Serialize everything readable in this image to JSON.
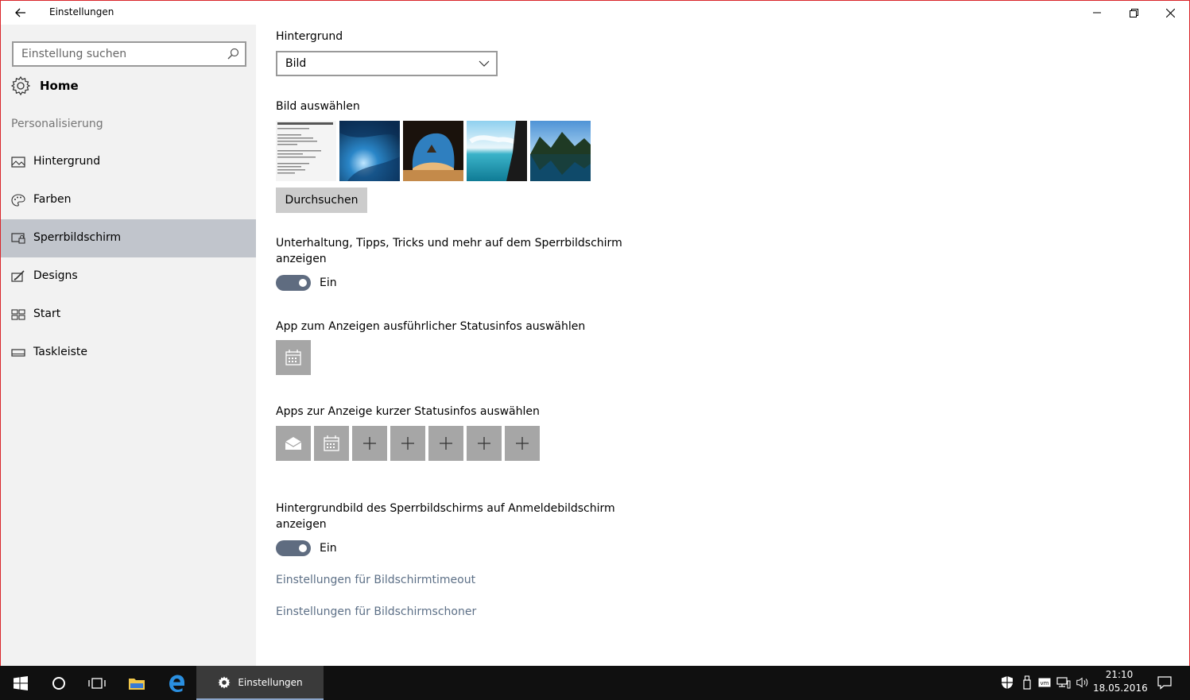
{
  "window": {
    "title": "Einstellungen"
  },
  "sidebar": {
    "search_placeholder": "Einstellung suchen",
    "home_label": "Home",
    "section_title": "Personalisierung",
    "items": [
      {
        "label": "Hintergrund",
        "icon": "image-icon",
        "active": false
      },
      {
        "label": "Farben",
        "icon": "palette-icon",
        "active": false
      },
      {
        "label": "Sperrbildschirm",
        "icon": "lockscreen-icon",
        "active": true
      },
      {
        "label": "Designs",
        "icon": "designs-icon",
        "active": false
      },
      {
        "label": "Start",
        "icon": "start-icon",
        "active": false
      },
      {
        "label": "Taskleiste",
        "icon": "taskbar-icon",
        "active": false
      }
    ]
  },
  "content": {
    "background_label": "Hintergrund",
    "background_value": "Bild",
    "choose_image_label": "Bild auswählen",
    "browse_label": "Durchsuchen",
    "tips_label_line1": "Unterhaltung, Tipps, Tricks und mehr auf dem Sperrbildschirm",
    "tips_label_line2": "anzeigen",
    "tips_toggle_text": "Ein",
    "detailed_status_label": "App zum Anzeigen ausführlicher Statusinfos auswählen",
    "quick_status_label": "Apps zur Anzeige kurzer Statusinfos auswählen",
    "signin_label_line1": "Hintergrundbild des Sperrbildschirms auf Anmeldebildschirm",
    "signin_label_line2": "anzeigen",
    "signin_toggle_text": "Ein",
    "timeout_link": "Einstellungen für Bildschirmtimeout",
    "screensaver_link": "Einstellungen für Bildschirmschoner"
  },
  "taskbar": {
    "active_app_label": "Einstellungen",
    "time": "21:10",
    "date": "18.05.2016"
  },
  "colors": {
    "toggle_on": "#5f6c80",
    "sidebar_active": "#c1c5cc",
    "link": "#5c6f86",
    "tile": "#a6a6a6"
  }
}
